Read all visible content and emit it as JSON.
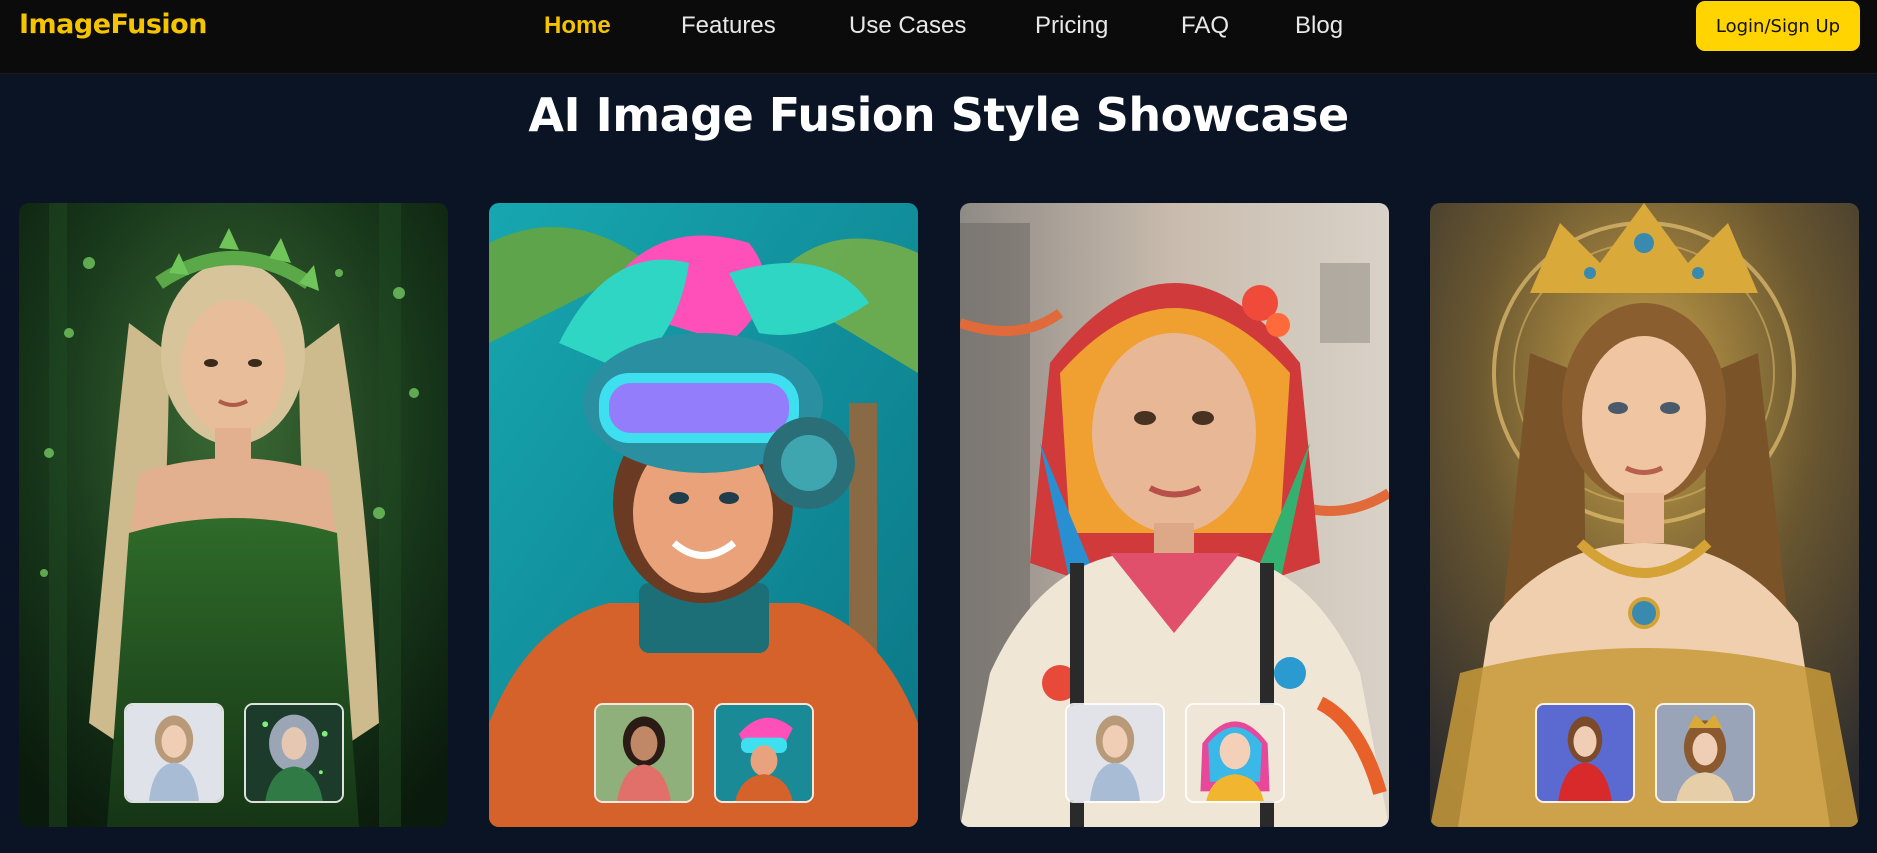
{
  "brand": {
    "name": "ImageFusion"
  },
  "nav": {
    "items": [
      {
        "label": "Home",
        "active": true
      },
      {
        "label": "Features"
      },
      {
        "label": "Use Cases"
      },
      {
        "label": "Pricing"
      },
      {
        "label": "FAQ"
      },
      {
        "label": "Blog"
      }
    ],
    "login_label": "Login/Sign Up"
  },
  "showcase": {
    "title": "AI Image Fusion Style Showcase",
    "cards": [
      {
        "style": "forest-fairy"
      },
      {
        "style": "tropical-cyber-helmet"
      },
      {
        "style": "rainbow-hair-casual"
      },
      {
        "style": "golden-crown-queen"
      }
    ]
  },
  "colors": {
    "accent": "#f5c400",
    "button": "#ffd400",
    "background": "#0a1424",
    "topbar": "#0b0b0b"
  }
}
